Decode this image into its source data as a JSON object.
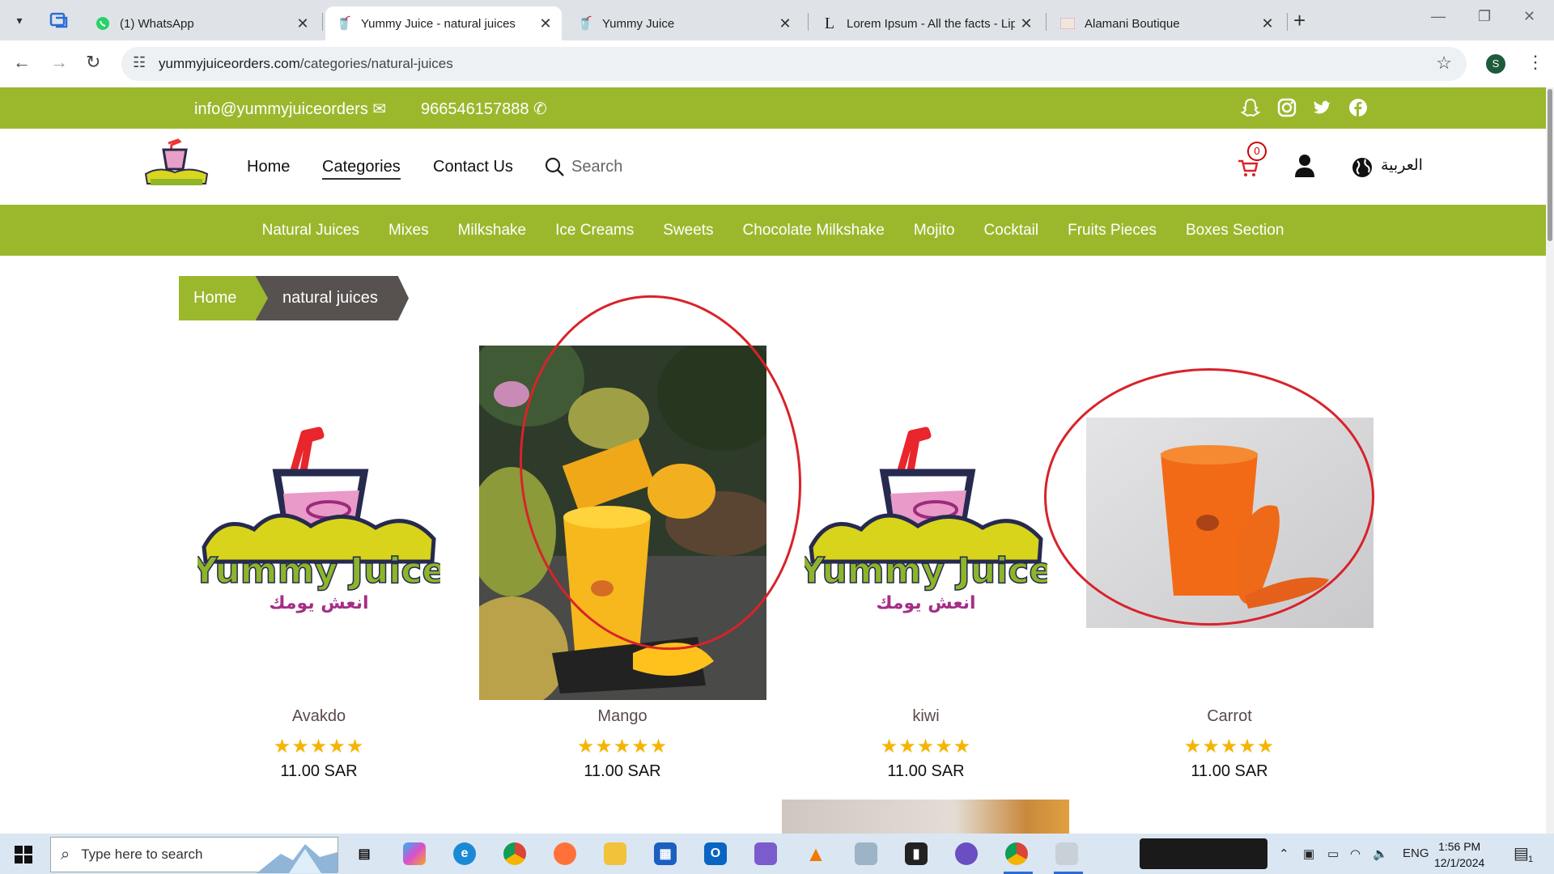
{
  "browser": {
    "tabs": [
      {
        "title": "(1) WhatsApp",
        "icon": "whatsapp-icon"
      },
      {
        "title": "Yummy Juice - natural juices",
        "icon": "yummy-favicon",
        "active": true
      },
      {
        "title": "Yummy Juice",
        "icon": "yummy-favicon"
      },
      {
        "title": "Lorem Ipsum - All the facts - Lip",
        "icon": "lipsum-favicon"
      },
      {
        "title": "Alamani Boutique",
        "icon": "boutique-favicon"
      }
    ],
    "url_host": "yummyjuiceorders.com",
    "url_path": "/categories/natural-juices",
    "profile_initial": "S"
  },
  "site": {
    "email": "info@yummyjuiceorders",
    "phone": "966546157888",
    "nav": {
      "home": "Home",
      "categories": "Categories",
      "contact": "Contact Us",
      "search": "Search"
    },
    "cart_count": "0",
    "language": "العربية",
    "categories": [
      "Natural Juices",
      "Mixes",
      "Milkshake",
      "Ice Creams",
      "Sweets",
      "Chocolate Milkshake",
      "Mojito",
      "Cocktail",
      "Fruits Pieces",
      "Boxes Section"
    ],
    "breadcrumb": {
      "home": "Home",
      "current": "natural juices"
    },
    "products": [
      {
        "name": "Avakdo",
        "rating": 5,
        "price": "11.00 SAR"
      },
      {
        "name": "Mango",
        "rating": 5,
        "price": "11.00 SAR"
      },
      {
        "name": "kiwi",
        "rating": 5,
        "price": "11.00 SAR"
      },
      {
        "name": "Carrot",
        "rating": 5,
        "price": "11.00 SAR"
      }
    ],
    "stars": "★★★★★",
    "logo_text": "Yummy Juice",
    "logo_arabic": "انعش يومك"
  },
  "taskbar": {
    "search_placeholder": "Type here to search",
    "lang": "ENG",
    "time": "1:56 PM",
    "date": "12/1/2024",
    "notif_count": "1"
  },
  "colors": {
    "brand_green": "#9bb82d",
    "breadcrumb_dark": "#57524f",
    "highlight_red": "#d8232a",
    "star_gold": "#f5b400"
  }
}
